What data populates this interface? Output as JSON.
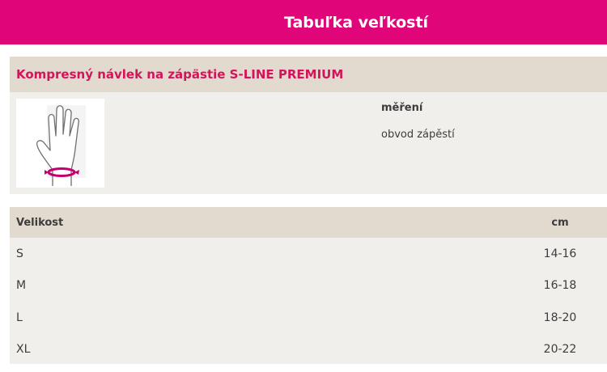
{
  "header": {
    "title": "Tabuľka veľkostí"
  },
  "product": {
    "title": "Kompresný návlek na zápästie S-LINE PREMIUM",
    "measure_label": "měření",
    "measure_desc": "obvod zápěstí",
    "figure_icon": "hand-wrist-measure-icon",
    "accent_color": "#d4145a"
  },
  "table": {
    "headers": {
      "size": "Velikost",
      "unit": "cm"
    },
    "rows": [
      {
        "size": "S",
        "range": "14-16"
      },
      {
        "size": "M",
        "range": "16-18"
      },
      {
        "size": "L",
        "range": "18-20"
      },
      {
        "size": "XL",
        "range": "20-22"
      }
    ]
  },
  "colors": {
    "header_bg": "#e0067a",
    "panel_bg": "#f1efeb",
    "panel_head_bg": "#e2d9cf"
  }
}
